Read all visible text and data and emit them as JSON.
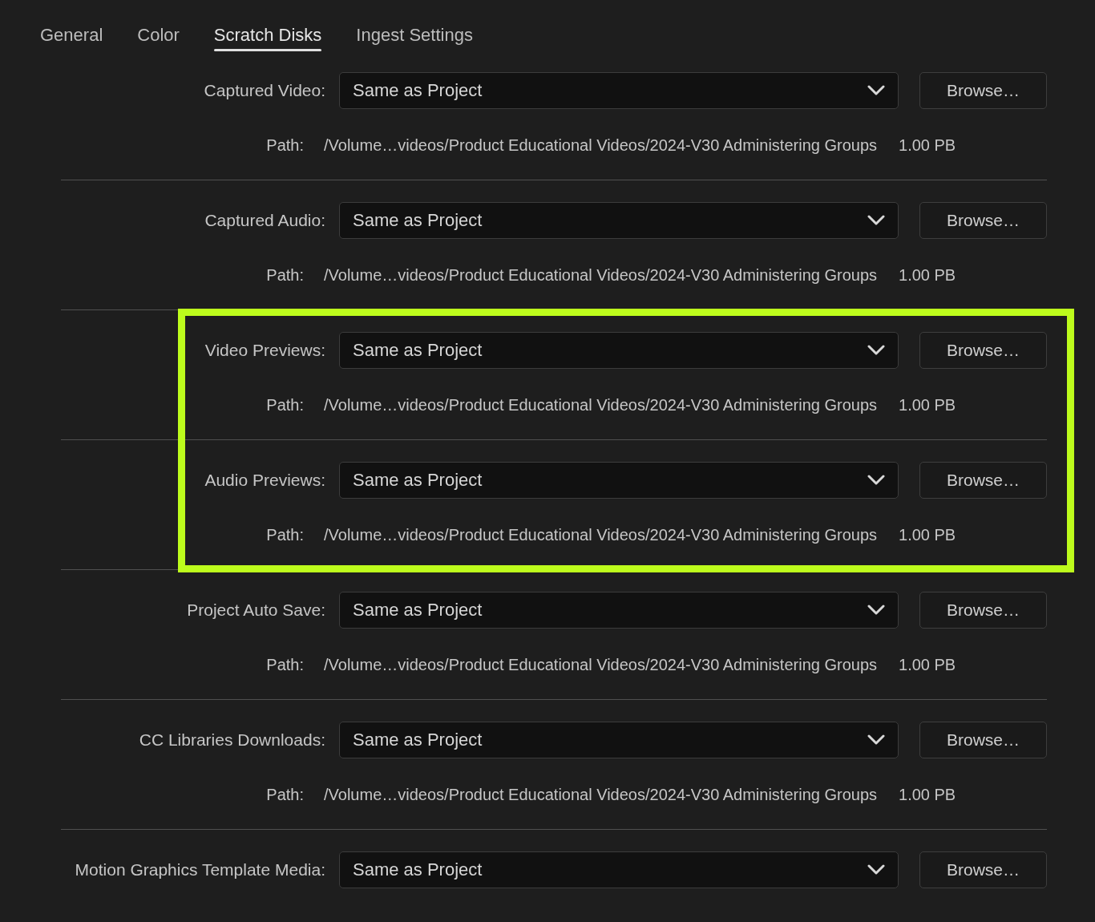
{
  "tabs": [
    {
      "label": "General",
      "selected": false
    },
    {
      "label": "Color",
      "selected": false
    },
    {
      "label": "Scratch Disks",
      "selected": true
    },
    {
      "label": "Ingest Settings",
      "selected": false
    }
  ],
  "sections": [
    {
      "label": "Captured Video:",
      "value": "Same as Project",
      "button": "Browse…",
      "highlighted": false,
      "path_label": "Path:",
      "path": "/Volume…videos/Product Educational Videos/2024-V30 Administering Groups",
      "size": "1.00 PB"
    },
    {
      "label": "Captured Audio:",
      "value": "Same as Project",
      "button": "Browse…",
      "highlighted": false,
      "path_label": "Path:",
      "path": "/Volume…videos/Product Educational Videos/2024-V30 Administering Groups",
      "size": "1.00 PB"
    },
    {
      "label": "Video Previews:",
      "value": "Same as Project",
      "button": "Browse…",
      "highlighted": true,
      "path_label": "Path:",
      "path": "/Volume…videos/Product Educational Videos/2024-V30 Administering Groups",
      "size": "1.00 PB"
    },
    {
      "label": "Audio Previews:",
      "value": "Same as Project",
      "button": "Browse…",
      "highlighted": true,
      "path_label": "Path:",
      "path": "/Volume…videos/Product Educational Videos/2024-V30 Administering Groups",
      "size": "1.00 PB"
    },
    {
      "label": "Project Auto Save:",
      "value": "Same as Project",
      "button": "Browse…",
      "highlighted": false,
      "path_label": "Path:",
      "path": "/Volume…videos/Product Educational Videos/2024-V30 Administering Groups",
      "size": "1.00 PB"
    },
    {
      "label": "CC Libraries Downloads:",
      "value": "Same as Project",
      "button": "Browse…",
      "highlighted": false,
      "path_label": "Path:",
      "path": "/Volume…videos/Product Educational Videos/2024-V30 Administering Groups",
      "size": "1.00 PB"
    },
    {
      "label": "Motion Graphics Template Media:",
      "value": "Same as Project",
      "button": "Browse…",
      "highlighted": false
    }
  ]
}
